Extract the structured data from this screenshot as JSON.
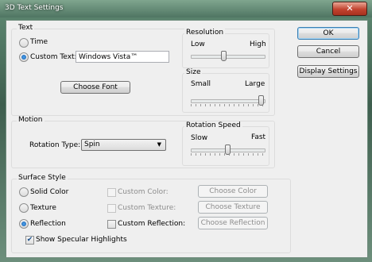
{
  "window": {
    "title": "3D Text Settings",
    "close_glyph": "✕"
  },
  "text_group": {
    "title": "Text",
    "time_label": "Time",
    "custom_text_label": "Custom Text:",
    "custom_text_value": "Windows Vista™",
    "choose_font_label": "Choose Font"
  },
  "resolution": {
    "title": "Resolution",
    "low_label": "Low",
    "high_label": "High",
    "level_percent": 45
  },
  "size": {
    "title": "Size",
    "small_label": "Small",
    "large_label": "Large",
    "level_percent": 100
  },
  "motion": {
    "title": "Motion",
    "rotation_type_label": "Rotation Type:",
    "rotation_type_value": "Spin"
  },
  "rotation_speed": {
    "title": "Rotation Speed",
    "slow_label": "Slow",
    "fast_label": "Fast",
    "level_percent": 50
  },
  "surface": {
    "title": "Surface Style",
    "solid_color_label": "Solid Color",
    "texture_label": "Texture",
    "reflection_label": "Reflection",
    "custom_color_label": "Custom Color:",
    "custom_texture_label": "Custom Texture:",
    "custom_reflection_label": "Custom Reflection:",
    "choose_color_label": "Choose Color",
    "choose_texture_label": "Choose Texture",
    "choose_reflection_label": "Choose Reflection",
    "specular_label": "Show Specular Highlights",
    "check_glyph": "✔"
  },
  "buttons": {
    "ok": "OK",
    "cancel": "Cancel",
    "display_settings": "Display Settings"
  },
  "colors": {
    "accent": "#3c7fb1",
    "glass": "#5f8a73"
  }
}
